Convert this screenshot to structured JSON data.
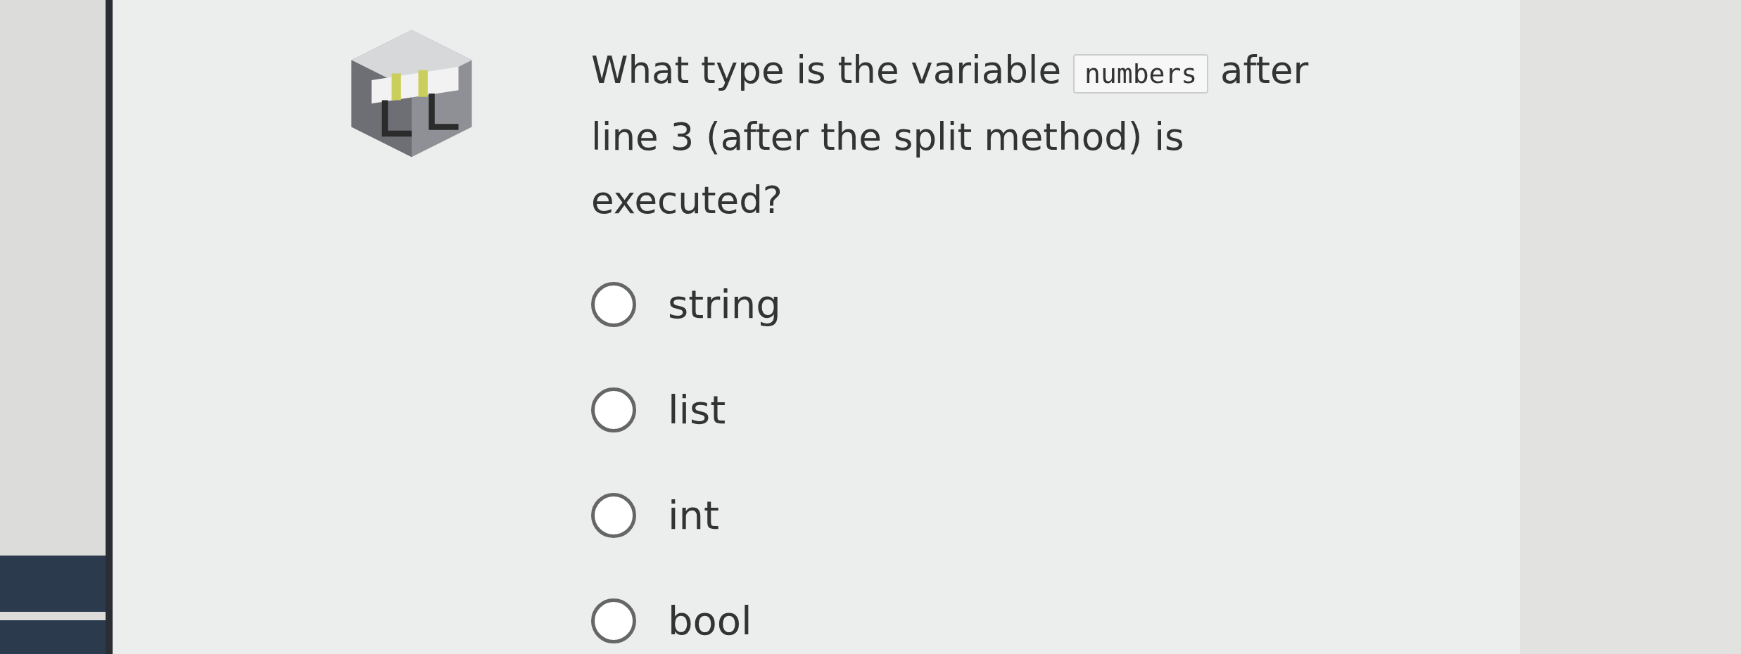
{
  "question": {
    "before": "What type is the variable",
    "code": "numbers",
    "after": "after line 3 (after the split method) is executed?"
  },
  "options": [
    {
      "label": "string",
      "selected": false
    },
    {
      "label": "list",
      "selected": false
    },
    {
      "label": "int",
      "selected": false
    },
    {
      "label": "bool",
      "selected": false
    }
  ]
}
